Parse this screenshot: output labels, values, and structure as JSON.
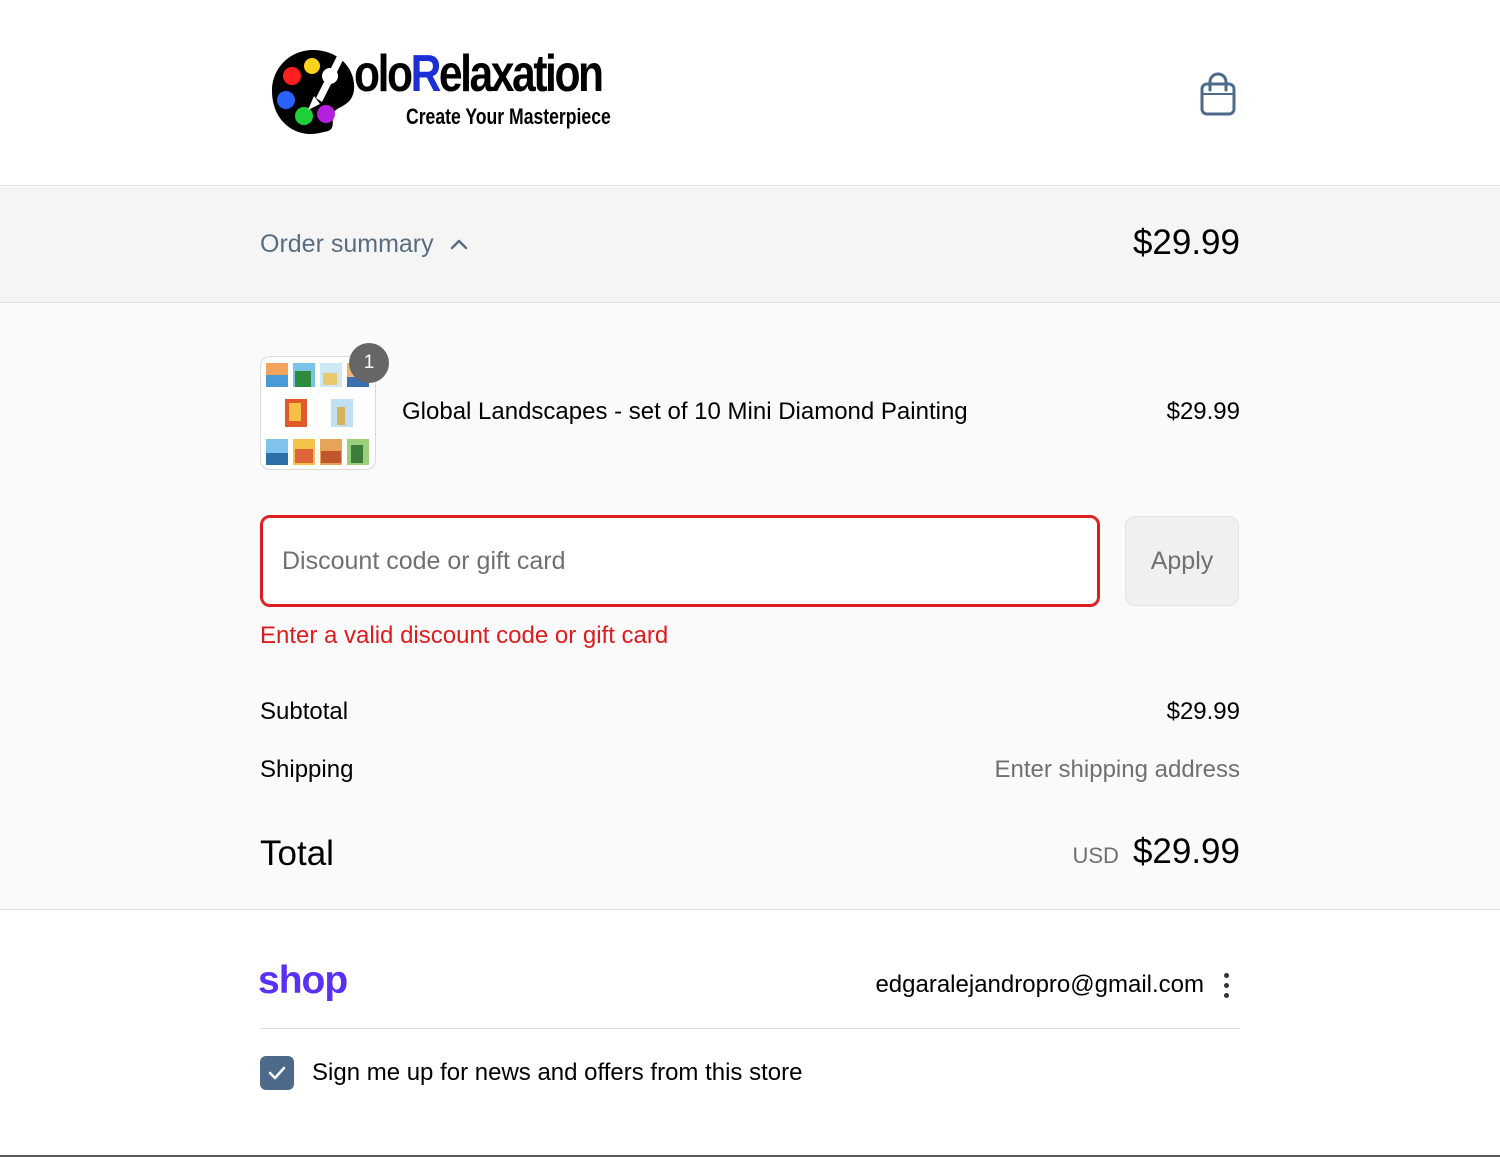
{
  "header": {
    "logo_text_prefix": "olo",
    "logo_text_accent": "R",
    "logo_text_suffix": "elaxation",
    "logo_tagline": "Create Your Masterpiece",
    "cart_icon": "shopping-bag-icon",
    "accent_color": "#1b2fd6"
  },
  "summary": {
    "toggle_label": "Order summary",
    "toggle_icon": "chevron-up-icon",
    "total": "$29.99"
  },
  "product": {
    "name": "Global Landscapes - set of 10 Mini Diamond Painting",
    "price": "$29.99",
    "quantity": "1"
  },
  "discount": {
    "placeholder": "Discount code or gift card",
    "value": "",
    "apply_label": "Apply",
    "error": "Enter a valid discount code or gift card",
    "error_color": "#dd1d1d"
  },
  "totals": {
    "subtotal_label": "Subtotal",
    "subtotal_value": "$29.99",
    "shipping_label": "Shipping",
    "shipping_value": "Enter shipping address",
    "total_label": "Total",
    "currency": "USD",
    "total_value": "$29.99"
  },
  "shop": {
    "logo": "shop",
    "logo_color": "#5a31f4",
    "email": "edgaralejandropro@gmail.com",
    "menu_icon": "kebab-menu-icon",
    "newsletter_label": "Sign me up for news and offers from this store",
    "newsletter_checked": true
  }
}
